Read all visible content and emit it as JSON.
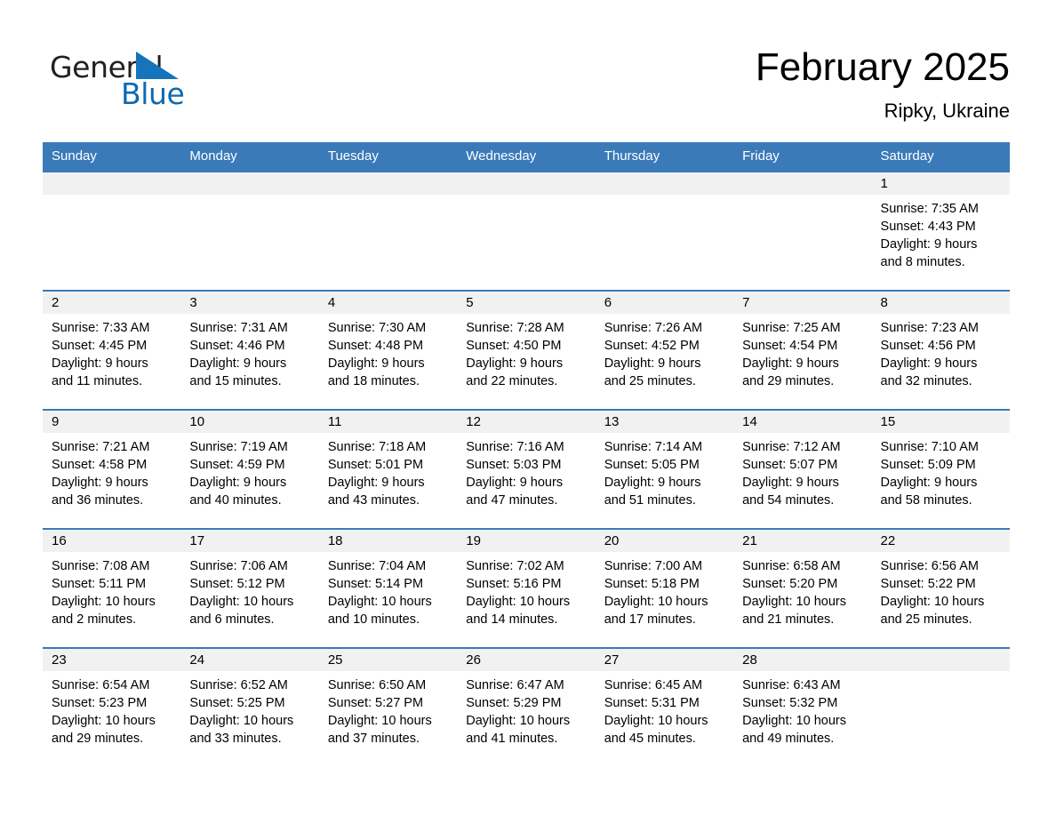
{
  "brand": {
    "word1": "General",
    "word2": "Blue",
    "triangle_color": "#1574bb",
    "word1_color": "#231f20",
    "word2_color": "#0d6ab0"
  },
  "header": {
    "title": "February 2025",
    "location": "Ripky, Ukraine"
  },
  "colors": {
    "header_bar": "#3a7ab9",
    "day_band": "#f1f1f1",
    "row_divider": "#3a7ab9",
    "text": "#000000"
  },
  "calendar": {
    "weekdays": [
      "Sunday",
      "Monday",
      "Tuesday",
      "Wednesday",
      "Thursday",
      "Friday",
      "Saturday"
    ],
    "weeks": [
      [
        {
          "day": "",
          "sunrise": "",
          "sunset": "",
          "daylight_1": "",
          "daylight_2": ""
        },
        {
          "day": "",
          "sunrise": "",
          "sunset": "",
          "daylight_1": "",
          "daylight_2": ""
        },
        {
          "day": "",
          "sunrise": "",
          "sunset": "",
          "daylight_1": "",
          "daylight_2": ""
        },
        {
          "day": "",
          "sunrise": "",
          "sunset": "",
          "daylight_1": "",
          "daylight_2": ""
        },
        {
          "day": "",
          "sunrise": "",
          "sunset": "",
          "daylight_1": "",
          "daylight_2": ""
        },
        {
          "day": "",
          "sunrise": "",
          "sunset": "",
          "daylight_1": "",
          "daylight_2": ""
        },
        {
          "day": "1",
          "sunrise": "Sunrise: 7:35 AM",
          "sunset": "Sunset: 4:43 PM",
          "daylight_1": "Daylight: 9 hours",
          "daylight_2": "and 8 minutes."
        }
      ],
      [
        {
          "day": "2",
          "sunrise": "Sunrise: 7:33 AM",
          "sunset": "Sunset: 4:45 PM",
          "daylight_1": "Daylight: 9 hours",
          "daylight_2": "and 11 minutes."
        },
        {
          "day": "3",
          "sunrise": "Sunrise: 7:31 AM",
          "sunset": "Sunset: 4:46 PM",
          "daylight_1": "Daylight: 9 hours",
          "daylight_2": "and 15 minutes."
        },
        {
          "day": "4",
          "sunrise": "Sunrise: 7:30 AM",
          "sunset": "Sunset: 4:48 PM",
          "daylight_1": "Daylight: 9 hours",
          "daylight_2": "and 18 minutes."
        },
        {
          "day": "5",
          "sunrise": "Sunrise: 7:28 AM",
          "sunset": "Sunset: 4:50 PM",
          "daylight_1": "Daylight: 9 hours",
          "daylight_2": "and 22 minutes."
        },
        {
          "day": "6",
          "sunrise": "Sunrise: 7:26 AM",
          "sunset": "Sunset: 4:52 PM",
          "daylight_1": "Daylight: 9 hours",
          "daylight_2": "and 25 minutes."
        },
        {
          "day": "7",
          "sunrise": "Sunrise: 7:25 AM",
          "sunset": "Sunset: 4:54 PM",
          "daylight_1": "Daylight: 9 hours",
          "daylight_2": "and 29 minutes."
        },
        {
          "day": "8",
          "sunrise": "Sunrise: 7:23 AM",
          "sunset": "Sunset: 4:56 PM",
          "daylight_1": "Daylight: 9 hours",
          "daylight_2": "and 32 minutes."
        }
      ],
      [
        {
          "day": "9",
          "sunrise": "Sunrise: 7:21 AM",
          "sunset": "Sunset: 4:58 PM",
          "daylight_1": "Daylight: 9 hours",
          "daylight_2": "and 36 minutes."
        },
        {
          "day": "10",
          "sunrise": "Sunrise: 7:19 AM",
          "sunset": "Sunset: 4:59 PM",
          "daylight_1": "Daylight: 9 hours",
          "daylight_2": "and 40 minutes."
        },
        {
          "day": "11",
          "sunrise": "Sunrise: 7:18 AM",
          "sunset": "Sunset: 5:01 PM",
          "daylight_1": "Daylight: 9 hours",
          "daylight_2": "and 43 minutes."
        },
        {
          "day": "12",
          "sunrise": "Sunrise: 7:16 AM",
          "sunset": "Sunset: 5:03 PM",
          "daylight_1": "Daylight: 9 hours",
          "daylight_2": "and 47 minutes."
        },
        {
          "day": "13",
          "sunrise": "Sunrise: 7:14 AM",
          "sunset": "Sunset: 5:05 PM",
          "daylight_1": "Daylight: 9 hours",
          "daylight_2": "and 51 minutes."
        },
        {
          "day": "14",
          "sunrise": "Sunrise: 7:12 AM",
          "sunset": "Sunset: 5:07 PM",
          "daylight_1": "Daylight: 9 hours",
          "daylight_2": "and 54 minutes."
        },
        {
          "day": "15",
          "sunrise": "Sunrise: 7:10 AM",
          "sunset": "Sunset: 5:09 PM",
          "daylight_1": "Daylight: 9 hours",
          "daylight_2": "and 58 minutes."
        }
      ],
      [
        {
          "day": "16",
          "sunrise": "Sunrise: 7:08 AM",
          "sunset": "Sunset: 5:11 PM",
          "daylight_1": "Daylight: 10 hours",
          "daylight_2": "and 2 minutes."
        },
        {
          "day": "17",
          "sunrise": "Sunrise: 7:06 AM",
          "sunset": "Sunset: 5:12 PM",
          "daylight_1": "Daylight: 10 hours",
          "daylight_2": "and 6 minutes."
        },
        {
          "day": "18",
          "sunrise": "Sunrise: 7:04 AM",
          "sunset": "Sunset: 5:14 PM",
          "daylight_1": "Daylight: 10 hours",
          "daylight_2": "and 10 minutes."
        },
        {
          "day": "19",
          "sunrise": "Sunrise: 7:02 AM",
          "sunset": "Sunset: 5:16 PM",
          "daylight_1": "Daylight: 10 hours",
          "daylight_2": "and 14 minutes."
        },
        {
          "day": "20",
          "sunrise": "Sunrise: 7:00 AM",
          "sunset": "Sunset: 5:18 PM",
          "daylight_1": "Daylight: 10 hours",
          "daylight_2": "and 17 minutes."
        },
        {
          "day": "21",
          "sunrise": "Sunrise: 6:58 AM",
          "sunset": "Sunset: 5:20 PM",
          "daylight_1": "Daylight: 10 hours",
          "daylight_2": "and 21 minutes."
        },
        {
          "day": "22",
          "sunrise": "Sunrise: 6:56 AM",
          "sunset": "Sunset: 5:22 PM",
          "daylight_1": "Daylight: 10 hours",
          "daylight_2": "and 25 minutes."
        }
      ],
      [
        {
          "day": "23",
          "sunrise": "Sunrise: 6:54 AM",
          "sunset": "Sunset: 5:23 PM",
          "daylight_1": "Daylight: 10 hours",
          "daylight_2": "and 29 minutes."
        },
        {
          "day": "24",
          "sunrise": "Sunrise: 6:52 AM",
          "sunset": "Sunset: 5:25 PM",
          "daylight_1": "Daylight: 10 hours",
          "daylight_2": "and 33 minutes."
        },
        {
          "day": "25",
          "sunrise": "Sunrise: 6:50 AM",
          "sunset": "Sunset: 5:27 PM",
          "daylight_1": "Daylight: 10 hours",
          "daylight_2": "and 37 minutes."
        },
        {
          "day": "26",
          "sunrise": "Sunrise: 6:47 AM",
          "sunset": "Sunset: 5:29 PM",
          "daylight_1": "Daylight: 10 hours",
          "daylight_2": "and 41 minutes."
        },
        {
          "day": "27",
          "sunrise": "Sunrise: 6:45 AM",
          "sunset": "Sunset: 5:31 PM",
          "daylight_1": "Daylight: 10 hours",
          "daylight_2": "and 45 minutes."
        },
        {
          "day": "28",
          "sunrise": "Sunrise: 6:43 AM",
          "sunset": "Sunset: 5:32 PM",
          "daylight_1": "Daylight: 10 hours",
          "daylight_2": "and 49 minutes."
        },
        {
          "day": "",
          "sunrise": "",
          "sunset": "",
          "daylight_1": "",
          "daylight_2": ""
        }
      ]
    ]
  }
}
